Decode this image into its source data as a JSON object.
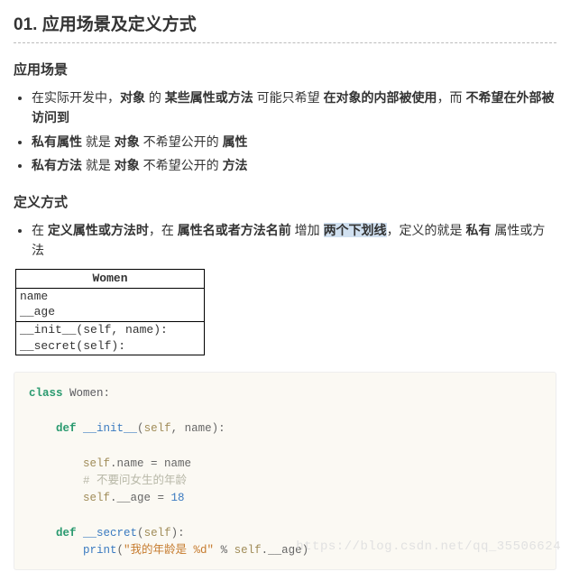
{
  "heading": "01. 应用场景及定义方式",
  "section1": {
    "title": "应用场景",
    "li1_p1": "在实际开发中，",
    "li1_b1": "对象",
    "li1_p2": " 的 ",
    "li1_b2": "某些属性或方法",
    "li1_p3": " 可能只希望 ",
    "li1_b3": "在对象的内部被使用",
    "li1_p4": "，而 ",
    "li1_b4": "不希望在外部被访问到",
    "li2_b1": "私有属性",
    "li2_p1": " 就是 ",
    "li2_b2": "对象",
    "li2_p2": " 不希望公开的 ",
    "li2_b3": "属性",
    "li3_b1": "私有方法",
    "li3_p1": " 就是 ",
    "li3_b2": "对象",
    "li3_p2": " 不希望公开的 ",
    "li3_b3": "方法"
  },
  "section2": {
    "title": "定义方式",
    "li1_p1": "在 ",
    "li1_b1": "定义属性或方法时",
    "li1_p2": "，在 ",
    "li1_b2": "属性名或者方法名前",
    "li1_p3": " 增加 ",
    "li1_hl": "两个下划线",
    "li1_p4": "，定义的就是 ",
    "li1_b3": "私有",
    "li1_p5": " 属性或方法"
  },
  "diagram": {
    "title": "Women",
    "attrs_line1": "name",
    "attrs_line2": "__age",
    "methods_line1": "__init__(self, name):",
    "methods_line2": "__secret(self):"
  },
  "code": {
    "kw_class": "class",
    "class_name": " Women",
    "colon": ":",
    "kw_def1": "def",
    "fn_init": " __init__",
    "params_init_open": "(",
    "self1": "self",
    "params_init_rest": ", name):",
    "l1a": "self",
    "l1b": ".name = name",
    "comment": "# 不要问女生的年龄",
    "l2a": "self",
    "l2b": ".__age = ",
    "num18": "18",
    "kw_def2": "def",
    "fn_secret": " __secret",
    "params_sec_open": "(",
    "self2": "self",
    "params_sec_rest": "):",
    "print_fn": "print",
    "print_open": "(",
    "str1": "\"我的年龄是 %d\"",
    "pct": " % ",
    "self3": "self",
    "tail": ".__age)"
  },
  "watermark": "https://blog.csdn.net/qq_35506624"
}
